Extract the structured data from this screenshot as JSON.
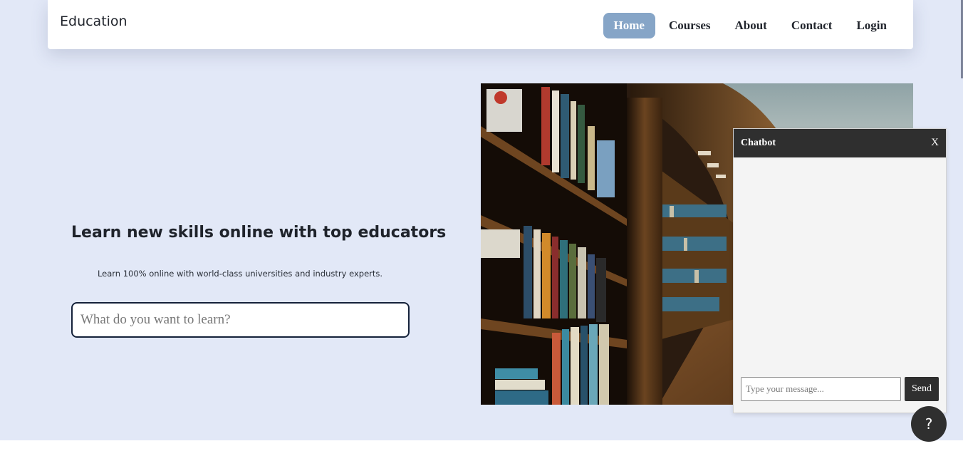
{
  "navbar": {
    "brand": "Education",
    "links": [
      {
        "label": "Home",
        "active": true
      },
      {
        "label": "Courses"
      },
      {
        "label": "About"
      },
      {
        "label": "Contact"
      },
      {
        "label": "Login"
      }
    ]
  },
  "hero": {
    "title": "Learn new skills online with top educators",
    "subtitle": "Learn 100% online with world-class universities and industry experts.",
    "search_placeholder": "What do you want to learn?"
  },
  "chatbot": {
    "title": "Chatbot",
    "close_label": "X",
    "input_placeholder": "Type your message...",
    "send_label": "Send"
  },
  "help": {
    "label": "?"
  },
  "colors": {
    "background": "#e2e8f7",
    "nav_active": "#86a5c7",
    "chat_dark": "#2f2f2f"
  }
}
